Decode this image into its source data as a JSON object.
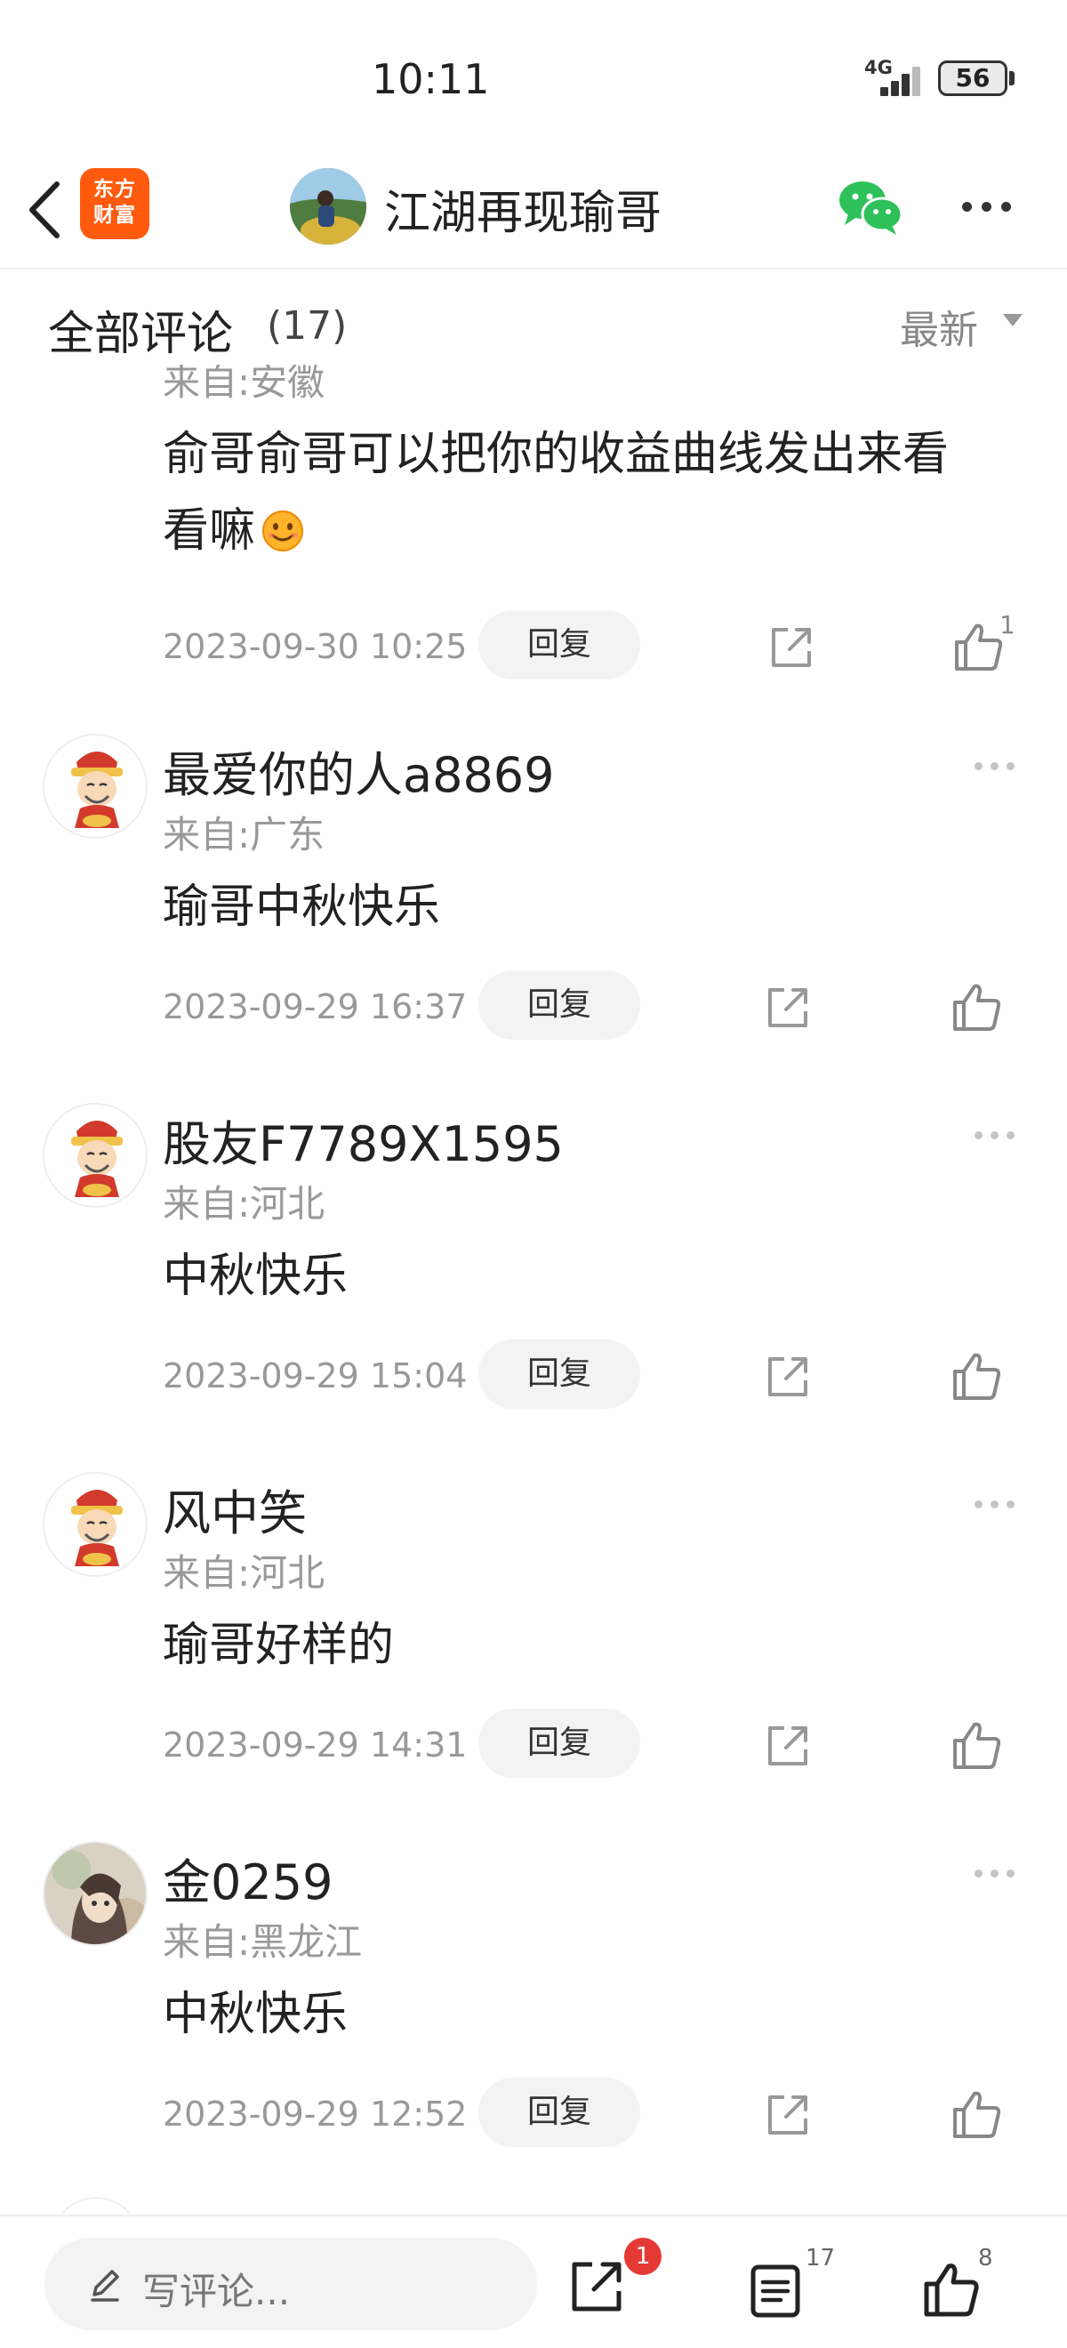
{
  "status_bar": {
    "time": "10:11",
    "network": "4G",
    "battery": "56"
  },
  "nav": {
    "logo_line1": "东方",
    "logo_line2": "财富",
    "title": "江湖再现瑜哥",
    "icons": [
      "chevron-left-icon",
      "wechat-icon",
      "more-icon"
    ]
  },
  "comments_header": {
    "title": "全部评论",
    "count": "(17)",
    "sort_label": "最新"
  },
  "comments": [
    {
      "region": "来自:安徽",
      "text_line1": "俞哥俞哥可以把你的收益曲线发出来看",
      "text_line2": "看嘛",
      "emoji": "smile-emoji",
      "time": "2023-09-30 10:25",
      "reply_label": "回复",
      "likes": "1"
    },
    {
      "name": "最爱你的人a8869",
      "region": "来自:广东",
      "text": "瑜哥中秋快乐",
      "time": "2023-09-29 16:37",
      "reply_label": "回复"
    },
    {
      "name": "股友F7789X1595",
      "region": "来自:河北",
      "text": "中秋快乐",
      "time": "2023-09-29 15:04",
      "reply_label": "回复"
    },
    {
      "name": "风中笑",
      "region": "来自:河北",
      "text": "瑜哥好样的",
      "time": "2023-09-29 14:31",
      "reply_label": "回复"
    },
    {
      "name": "金0259",
      "region": "来自:黑龙江",
      "text": "中秋快乐",
      "time": "2023-09-29 12:52",
      "reply_label": "回复"
    }
  ],
  "bottom_bar": {
    "write_placeholder": "写评论...",
    "share_badge": "1",
    "comment_count": "17",
    "like_count": "8"
  },
  "colors": {
    "brand": "#ff5a0e",
    "badge": "#e53935",
    "wechat": "#2ec15a"
  }
}
